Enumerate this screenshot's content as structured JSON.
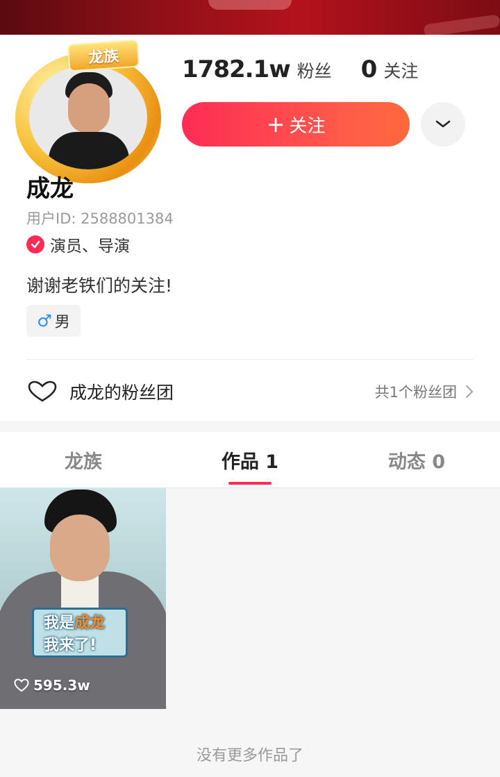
{
  "profile": {
    "badge": "龙族",
    "followers_count": "1782.1w",
    "followers_label": "粉丝",
    "following_count": "0",
    "following_label": "关注",
    "follow_button": "关注",
    "name": "成龙",
    "user_id": "用户ID: 2588801384",
    "verification": "演员、导演",
    "bio": "谢谢老铁们的关注!",
    "gender": "男"
  },
  "fan_club": {
    "title": "成龙的粉丝团",
    "count": "共1个粉丝团"
  },
  "tabs": [
    {
      "label": "龙族"
    },
    {
      "label": "作品 1"
    },
    {
      "label": "动态 0"
    }
  ],
  "works": [
    {
      "caption_line1_a": "我是",
      "caption_line1_b": "成龙",
      "caption_line2": "我来了!",
      "likes": "595.3w"
    }
  ],
  "footer": {
    "no_more": "没有更多作品了"
  },
  "colors": {
    "accent": "#fe2c55",
    "banner": "#8e1018"
  }
}
